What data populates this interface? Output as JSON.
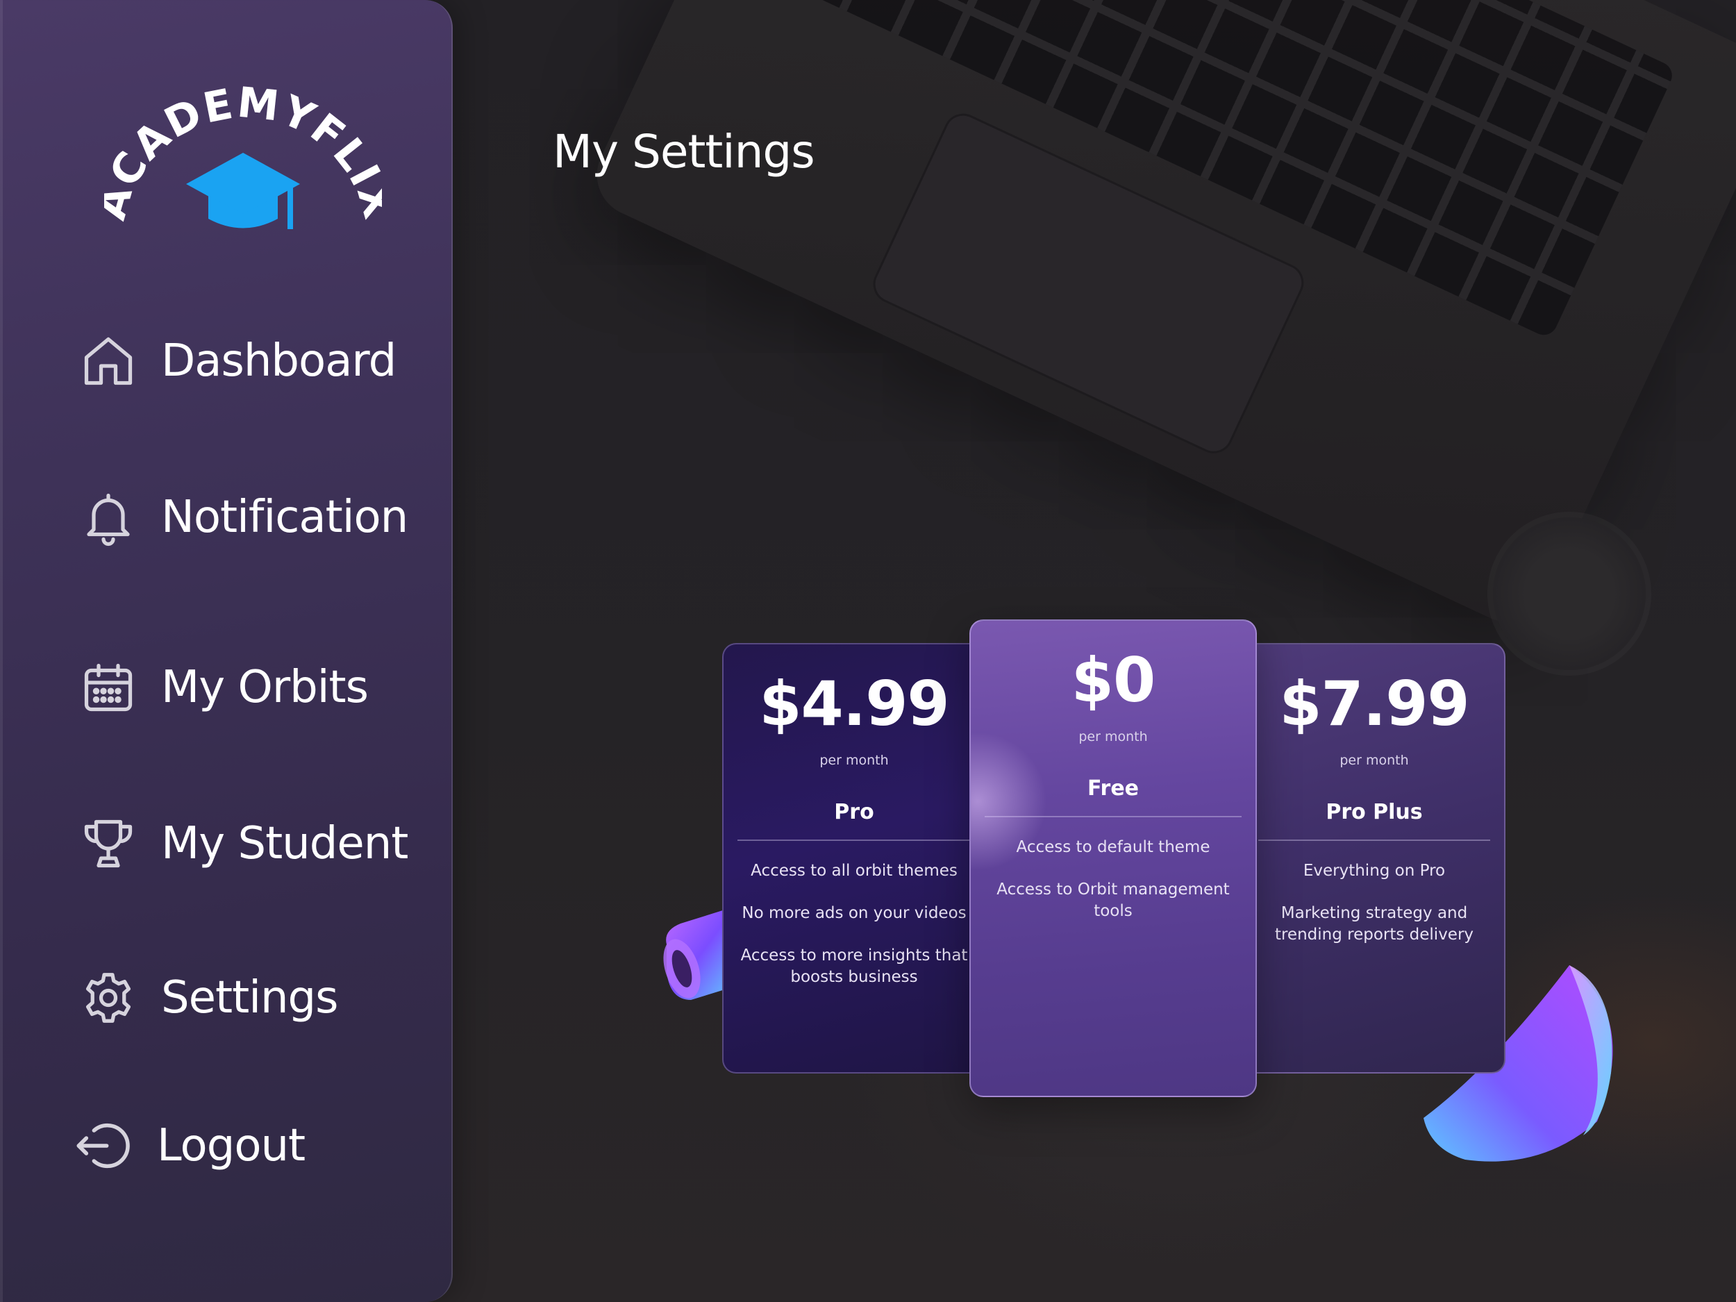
{
  "page": {
    "title": "My Settings"
  },
  "logo": {
    "text": "ACADEMYFLIX",
    "icon": "graduation-cap-icon",
    "icon_color": "#1aa3f2"
  },
  "sidebar": {
    "items": [
      {
        "label": "Dashboard",
        "icon": "home-icon"
      },
      {
        "label": "Notification",
        "icon": "bell-icon"
      },
      {
        "label": "My Orbits",
        "icon": "calendar-icon"
      },
      {
        "label": "My Student",
        "icon": "trophy-icon"
      },
      {
        "label": "Settings",
        "icon": "gear-icon"
      },
      {
        "label": "Logout",
        "icon": "logout-icon"
      }
    ]
  },
  "plans": [
    {
      "price": "$4.99",
      "period": "per month",
      "name": "Pro",
      "features": [
        "Access to all orbit themes",
        "No more ads on your videos",
        "Access to more insights that boosts business"
      ]
    },
    {
      "price": "$0",
      "period": "per month",
      "name": "Free",
      "features": [
        "Access to default theme",
        "Access to Orbit management tools"
      ]
    },
    {
      "price": "$7.99",
      "period": "per month",
      "name": "Pro Plus",
      "features": [
        "Everything on Pro",
        "Marketing strategy and trending reports delivery"
      ]
    }
  ],
  "colors": {
    "sidebar_top": "#4a3a66",
    "sidebar_bottom": "#2f2942",
    "background": "#232225",
    "card_free": "#6547a0",
    "card_pro": "#2a1a62",
    "card_plus": "#3f2f68",
    "accent_blue": "#1aa3f2"
  }
}
